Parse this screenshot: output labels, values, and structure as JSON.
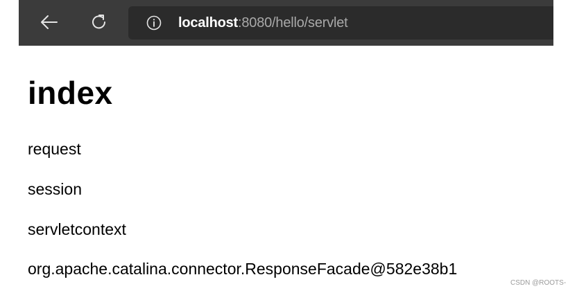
{
  "browser": {
    "url_host": "localhost",
    "url_rest": ":8080/hello/servlet",
    "icons": {
      "back": "arrow-left-icon",
      "reload": "reload-icon",
      "info": "info-icon"
    }
  },
  "page": {
    "title": "index",
    "lines": [
      "request",
      "session",
      "servletcontext",
      "org.apache.catalina.connector.ResponseFacade@582e38b1"
    ]
  },
  "watermark": "CSDN @ROOTS-"
}
